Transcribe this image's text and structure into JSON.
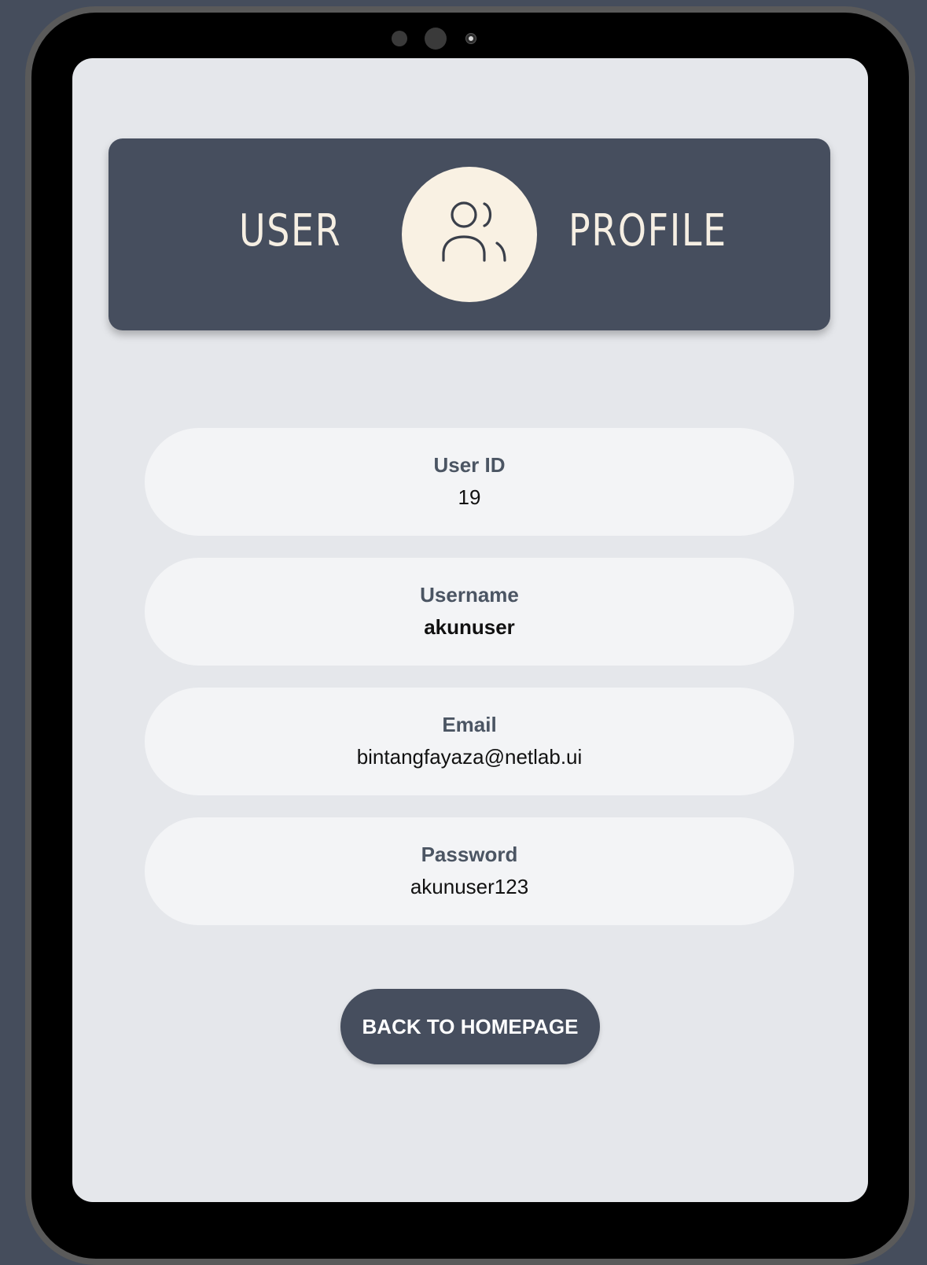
{
  "header": {
    "title_left": "USER",
    "title_right": "PROFILE",
    "icon": "users-icon"
  },
  "fields": [
    {
      "label": "User ID",
      "value": "19"
    },
    {
      "label": "Username",
      "value": "akunuser"
    },
    {
      "label": "Email",
      "value": "bintangfayaza@netlab.ui"
    },
    {
      "label": "Password",
      "value": "akunuser123"
    }
  ],
  "actions": {
    "back_label": "BACK TO HOMEPAGE"
  },
  "colors": {
    "page_background": "#454d5c",
    "screen_background": "#e5e7eb",
    "header_background": "#464e5e",
    "avatar_background": "#f9f1e3",
    "card_background": "#f3f4f6",
    "button_background": "#464e5e"
  }
}
